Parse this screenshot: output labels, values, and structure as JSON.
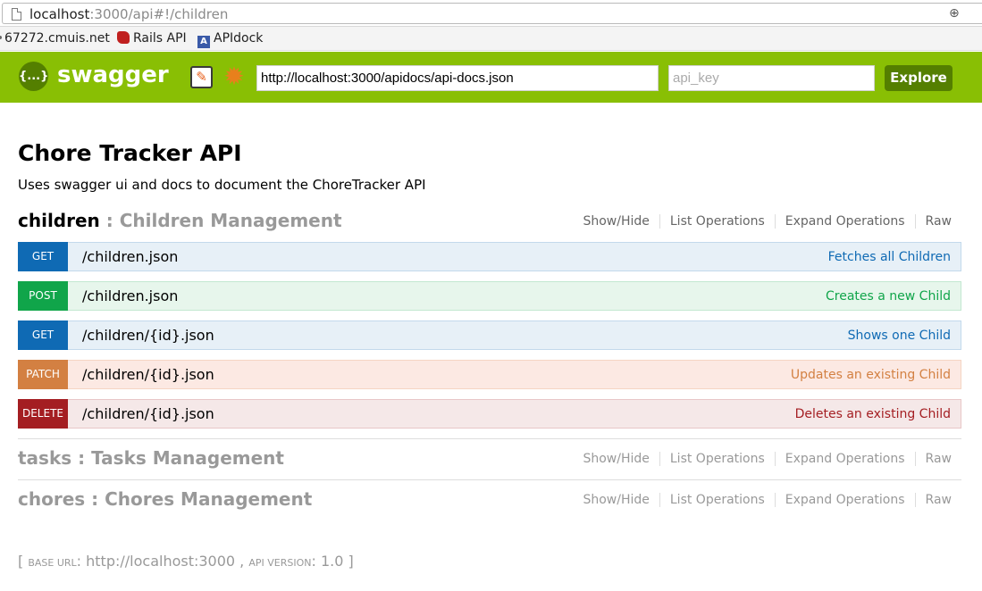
{
  "browser": {
    "url_host": "localhost",
    "url_rest": ":3000/api#!/children",
    "bookmarks": [
      {
        "label": "67272.cmuis.net"
      },
      {
        "label": "Rails API"
      },
      {
        "label": "APIdock"
      }
    ]
  },
  "header": {
    "logo_glyph": "{...}",
    "title": "swagger",
    "url_value": "http://localhost:3000/apidocs/api-docs.json",
    "api_key_placeholder": "api_key",
    "explore_label": "Explore",
    "colors": {
      "bar": "#89bf04",
      "dark": "#547f00"
    }
  },
  "info": {
    "title": "Chore Tracker API",
    "description": "Uses swagger ui and docs to document the ChoreTracker API"
  },
  "resources": [
    {
      "name": "children",
      "separator": " : ",
      "description": "Children Management",
      "ops_links": [
        "Show/Hide",
        "List Operations",
        "Expand Operations",
        "Raw"
      ],
      "operations": [
        {
          "method": "GET",
          "path": "/children.json",
          "summary": "Fetches all Children"
        },
        {
          "method": "POST",
          "path": "/children.json",
          "summary": "Creates a new Child"
        },
        {
          "method": "GET",
          "path": "/children/{id}.json",
          "summary": "Shows one Child"
        },
        {
          "method": "PATCH",
          "path": "/children/{id}.json",
          "summary": "Updates an existing Child"
        },
        {
          "method": "DELETE",
          "path": "/children/{id}.json",
          "summary": "Deletes an existing Child"
        }
      ]
    },
    {
      "name": "tasks",
      "separator": " : ",
      "description": "Tasks Management",
      "ops_links": [
        "Show/Hide",
        "List Operations",
        "Expand Operations",
        "Raw"
      ]
    },
    {
      "name": "chores",
      "separator": " : ",
      "description": "Chores Management",
      "ops_links": [
        "Show/Hide",
        "List Operations",
        "Expand Operations",
        "Raw"
      ]
    }
  ],
  "footer": {
    "open": "[ ",
    "base_url_label": "base url",
    "colon1": ": ",
    "base_url": "http://localhost:3000",
    "comma": " , ",
    "api_version_label": "api version",
    "colon2": ": ",
    "api_version": "1.0",
    "close": " ]"
  }
}
